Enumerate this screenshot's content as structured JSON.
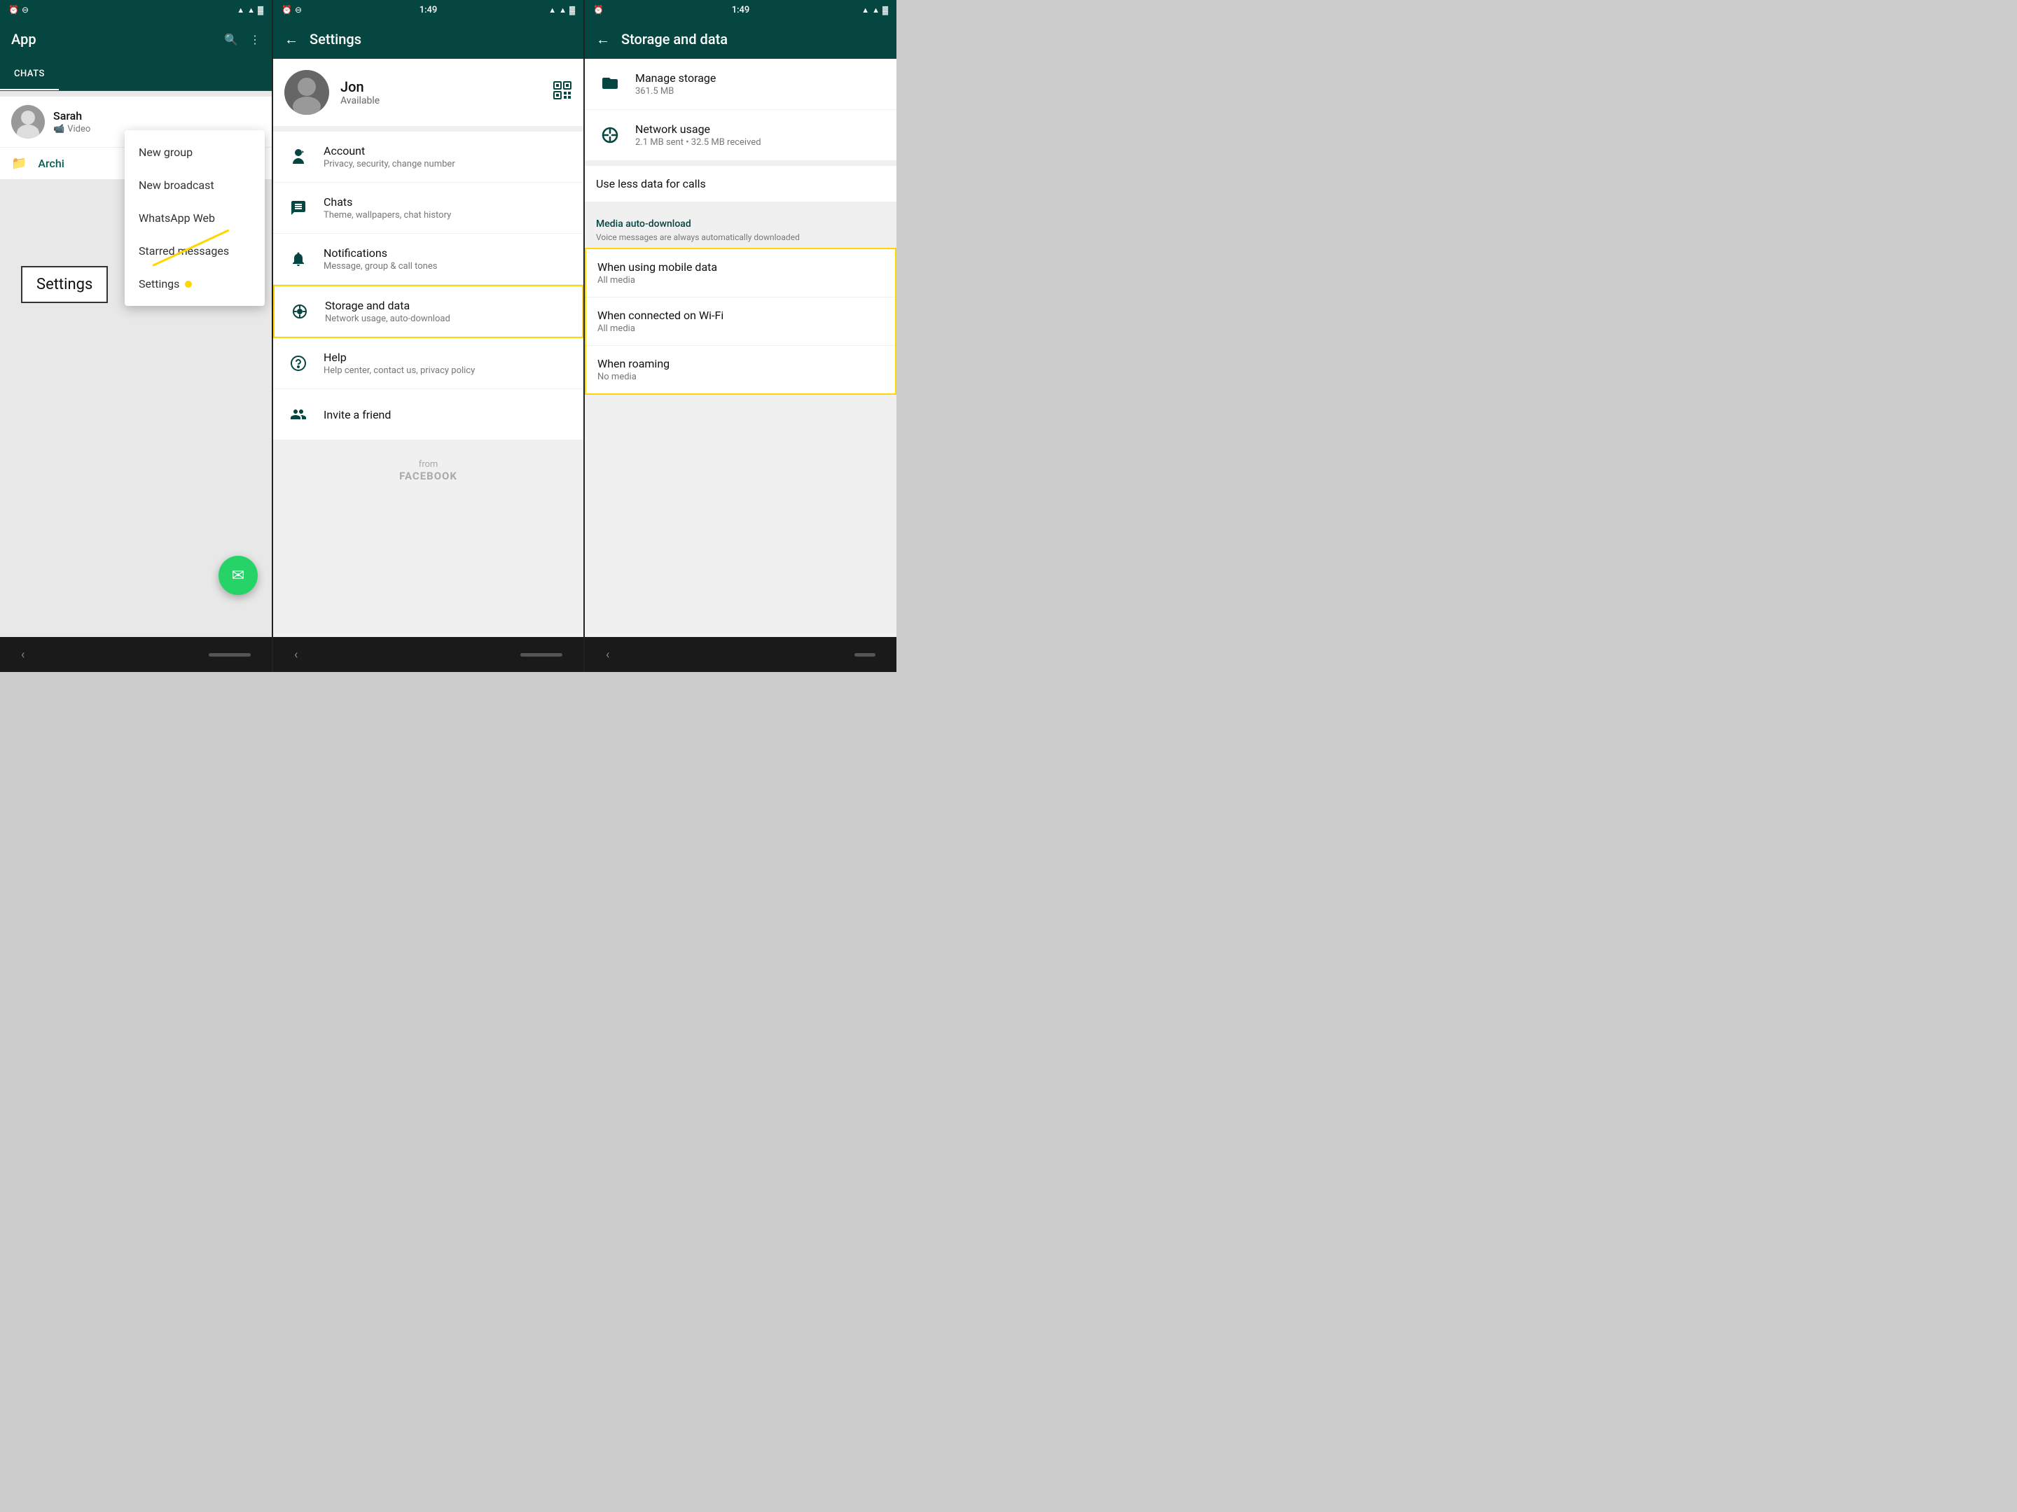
{
  "panel1": {
    "title": "App",
    "tab_active": "CHATS",
    "tabs": [
      "CHATS"
    ],
    "chat_items": [
      {
        "name": "Sarah",
        "preview": "Video",
        "has_video_icon": true
      }
    ],
    "archive_label": "Archi",
    "dropdown": {
      "items": [
        {
          "id": "new-group",
          "label": "New group",
          "has_dot": false
        },
        {
          "id": "new-broadcast",
          "label": "New broadcast",
          "has_dot": false
        },
        {
          "id": "whatsapp-web",
          "label": "WhatsApp Web",
          "has_dot": false
        },
        {
          "id": "starred-messages",
          "label": "Starred messages",
          "has_dot": false
        },
        {
          "id": "settings",
          "label": "Settings",
          "has_dot": true
        }
      ]
    },
    "fab_icon": "✉",
    "tooltip_label": "Settings",
    "status_bar": {
      "left": [
        "⏰",
        "⊖"
      ],
      "right": [
        "▲",
        "▲",
        "▄",
        "🔋"
      ]
    }
  },
  "panel2": {
    "title": "Settings",
    "time": "1:49",
    "user": {
      "name": "Jon",
      "status": "Available"
    },
    "settings_items": [
      {
        "id": "account",
        "icon": "key",
        "title": "Account",
        "subtitle": "Privacy, security, change number"
      },
      {
        "id": "chats",
        "icon": "chat",
        "title": "Chats",
        "subtitle": "Theme, wallpapers, chat history"
      },
      {
        "id": "notifications",
        "icon": "bell",
        "title": "Notifications",
        "subtitle": "Message, group & call tones"
      },
      {
        "id": "storage",
        "icon": "data",
        "title": "Storage and data",
        "subtitle": "Network usage, auto-download",
        "active": true
      },
      {
        "id": "help",
        "icon": "help",
        "title": "Help",
        "subtitle": "Help center, contact us, privacy policy"
      },
      {
        "id": "invite",
        "icon": "invite",
        "title": "Invite a friend",
        "subtitle": ""
      }
    ],
    "footer": {
      "from_label": "from",
      "brand_label": "FACEBOOK"
    },
    "status_bar": {
      "time": "1:49"
    }
  },
  "panel3": {
    "title": "Storage and data",
    "time": "1:49",
    "manage_storage": {
      "title": "Manage storage",
      "size": "361.5 MB"
    },
    "network_usage": {
      "title": "Network usage",
      "detail": "2.1 MB sent • 32.5 MB received"
    },
    "use_less_data": {
      "title": "Use less data for calls"
    },
    "media_auto_download": {
      "section_label": "Media auto-download",
      "description": "Voice messages are always automatically downloaded"
    },
    "media_items": [
      {
        "id": "mobile-data",
        "title": "When using mobile data",
        "subtitle": "All media"
      },
      {
        "id": "wifi",
        "title": "When connected on Wi-Fi",
        "subtitle": "All media"
      },
      {
        "id": "roaming",
        "title": "When roaming",
        "subtitle": "No media"
      }
    ],
    "status_bar": {
      "time": "1:49"
    }
  }
}
